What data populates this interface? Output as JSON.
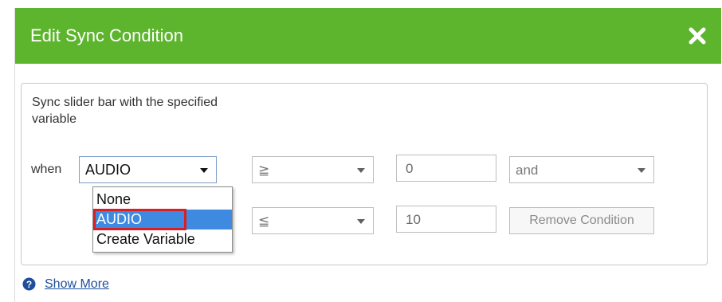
{
  "dialog": {
    "title": "Edit Sync Condition",
    "close_icon": "close-icon",
    "accent_color": "#5db52d"
  },
  "panel": {
    "description": "Sync slider bar with the specified variable",
    "when_label": "when"
  },
  "row1": {
    "variable_select": "AUDIO",
    "operator_select": "≧",
    "value_input": "0",
    "conjunction_select": "and"
  },
  "row2": {
    "operator_select": "≦",
    "value_input": "10",
    "remove_button": "Remove Condition"
  },
  "variable_dropdown": {
    "options": [
      "None",
      "AUDIO",
      "Create Variable"
    ],
    "selected": "AUDIO",
    "selected_color": "#3d8ae0",
    "highlight_color": "#d81f26"
  },
  "footer": {
    "help_icon": "help-icon",
    "show_more": "Show More"
  }
}
